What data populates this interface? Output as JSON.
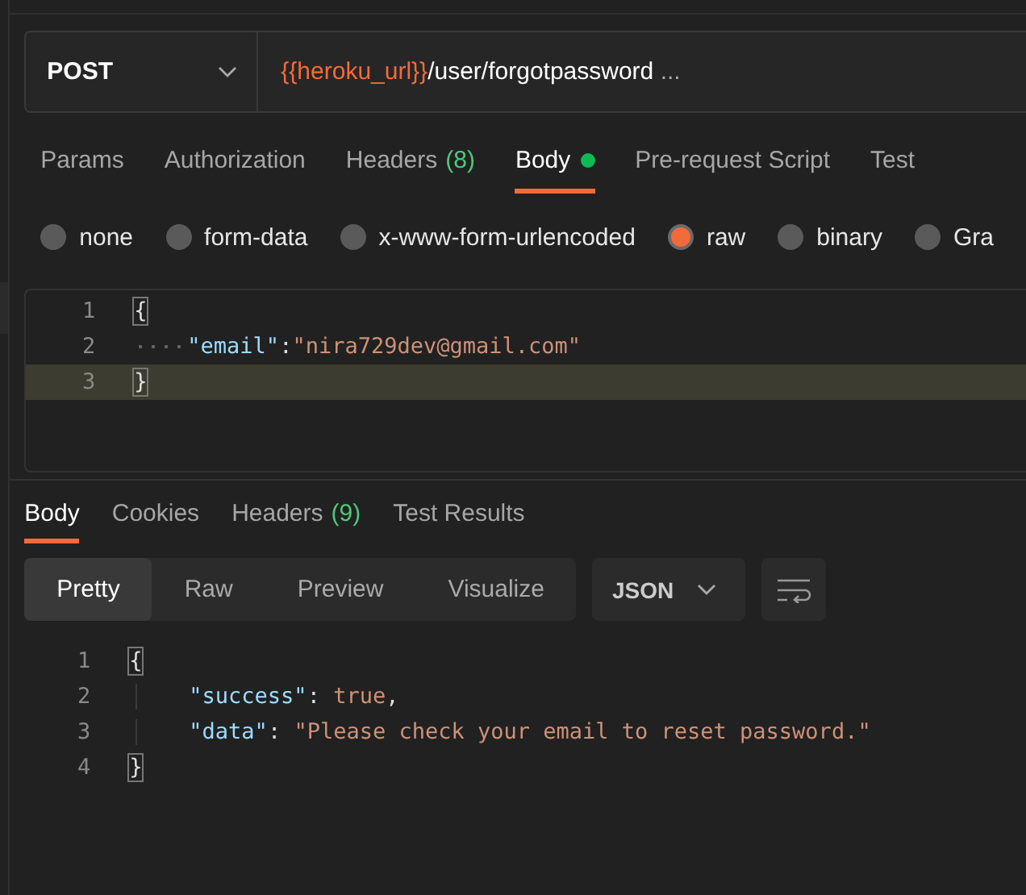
{
  "request": {
    "method": "POST",
    "url_variable": "{{heroku_url}}",
    "url_path": "/user/forgotpassword",
    "url_more": "..."
  },
  "request_tabs": [
    {
      "label": "Params",
      "selected": false
    },
    {
      "label": "Authorization",
      "selected": false
    },
    {
      "label": "Headers",
      "count": "(8)",
      "selected": false
    },
    {
      "label": "Body",
      "dot": true,
      "selected": true
    },
    {
      "label": "Pre-request Script",
      "selected": false
    },
    {
      "label": "Test",
      "selected": false
    }
  ],
  "body_types": [
    {
      "label": "none",
      "selected": false
    },
    {
      "label": "form-data",
      "selected": false
    },
    {
      "label": "x-www-form-urlencoded",
      "selected": false
    },
    {
      "label": "raw",
      "selected": true
    },
    {
      "label": "binary",
      "selected": false
    },
    {
      "label": "Gra",
      "selected": false
    }
  ],
  "request_body": [
    {
      "number": "1",
      "current": false,
      "tokens": [
        {
          "kind": "bracket",
          "text": "{"
        }
      ]
    },
    {
      "number": "2",
      "current": false,
      "indented": true,
      "whitespace_dots": true,
      "tokens": [
        {
          "kind": "key",
          "text": "\"email\""
        },
        {
          "kind": "punct",
          "text": ":"
        },
        {
          "kind": "string",
          "text": "\"nira729dev@gmail.com\""
        }
      ]
    },
    {
      "number": "3",
      "current": true,
      "tokens": [
        {
          "kind": "bracket",
          "text": "}"
        }
      ]
    }
  ],
  "response_tabs": [
    {
      "label": "Body",
      "selected": true
    },
    {
      "label": "Cookies",
      "selected": false
    },
    {
      "label": "Headers",
      "count": "(9)",
      "selected": false
    },
    {
      "label": "Test Results",
      "selected": false
    }
  ],
  "view_modes": [
    {
      "label": "Pretty",
      "selected": true
    },
    {
      "label": "Raw",
      "selected": false
    },
    {
      "label": "Preview",
      "selected": false
    },
    {
      "label": "Visualize",
      "selected": false
    }
  ],
  "format": "JSON",
  "response_body": [
    {
      "number": "1",
      "current": false,
      "tokens": [
        {
          "kind": "bracket",
          "text": "{"
        }
      ]
    },
    {
      "number": "2",
      "current": false,
      "indented": true,
      "whitespace_dots": false,
      "tokens": [
        {
          "kind": "key",
          "text": "\"success\""
        },
        {
          "kind": "punct",
          "text": ": "
        },
        {
          "kind": "value",
          "text": "true"
        },
        {
          "kind": "punct",
          "text": ","
        }
      ]
    },
    {
      "number": "3",
      "current": false,
      "indented": true,
      "whitespace_dots": false,
      "tokens": [
        {
          "kind": "key",
          "text": "\"data\""
        },
        {
          "kind": "punct",
          "text": ": "
        },
        {
          "kind": "string",
          "text": "\"Please check your email to reset password.\""
        }
      ]
    },
    {
      "number": "4",
      "current": false,
      "tokens": [
        {
          "kind": "bracket",
          "text": "}"
        }
      ]
    }
  ]
}
